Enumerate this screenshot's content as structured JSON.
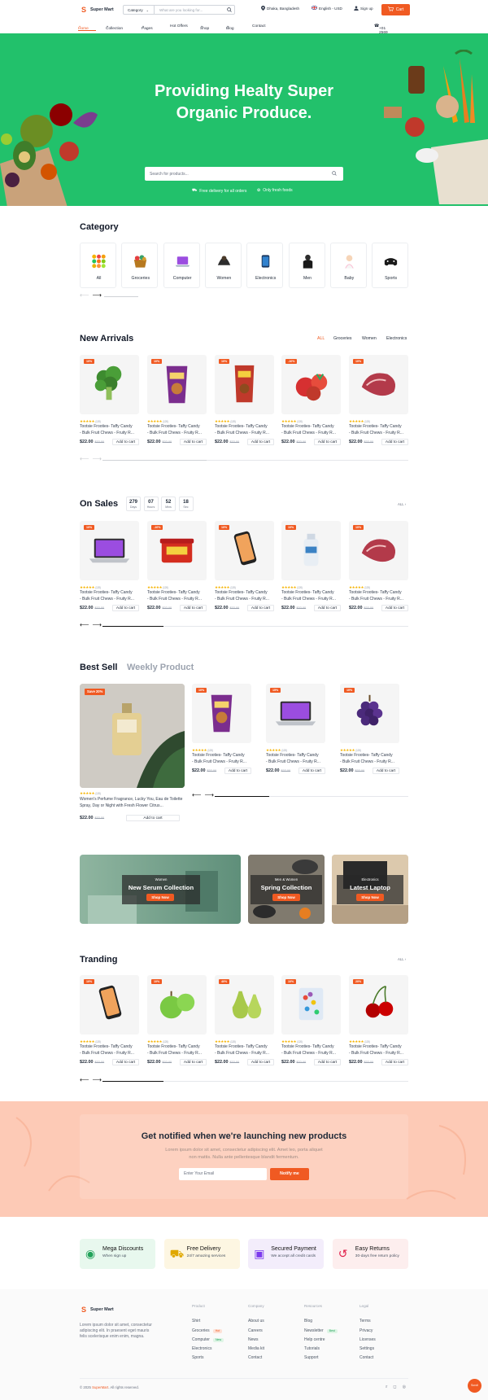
{
  "header": {
    "logo_letter": "S",
    "logo_name": "Super Mart",
    "category_label": "Category",
    "search_placeholder": "What are you looking for...",
    "location": "Dhaka, Bangladesh",
    "language": "English - USD",
    "signup": "Sign up",
    "cart": "Cart"
  },
  "nav": {
    "items": [
      "Home",
      "Collection",
      "Pages",
      "Hot Offers",
      "Shop",
      "Blog",
      "Contact"
    ],
    "phone": "+01 2569 8889"
  },
  "hero": {
    "title": "Providing Healty Super\nOrganic Produce.",
    "search_placeholder": "Search for products...",
    "feature1": "Free delivery for all orders",
    "feature2": "Only fresh foods"
  },
  "category": {
    "title": "Category",
    "items": [
      "All",
      "Groceries",
      "Computer",
      "Women",
      "Electronics",
      "Men",
      "Baby",
      "Sports"
    ]
  },
  "product": {
    "title": "Tootsie Frooties- Taffy Candy\n- Bulk Fruit Chews - Fruity R...",
    "price": "$22.00",
    "old_price": "$32.00",
    "add_to_cart": "Add to cart",
    "reviews": "(120)"
  },
  "new_arrivals": {
    "title": "New Arrivals",
    "filters": [
      "ALL",
      "Groceries",
      "Women",
      "Electronics"
    ],
    "badges": [
      "10%",
      "10%",
      "10%",
      "-10%",
      "10%"
    ],
    "items": [
      "broccoli",
      "candy-bag",
      "snack-bag",
      "tomatoes",
      "meat"
    ]
  },
  "on_sales": {
    "title": "On Sales",
    "countdown": [
      {
        "value": "279",
        "unit": "Days"
      },
      {
        "value": "07",
        "unit": "Hours"
      },
      {
        "value": "52",
        "unit": "Mins"
      },
      {
        "value": "18",
        "unit": "Sec"
      }
    ],
    "all_label": "ALL",
    "badges": [
      "10%",
      "-10%",
      "10%",
      "10%",
      "10%"
    ],
    "items": [
      "laptop",
      "candy-tub",
      "phone",
      "lotion",
      "meat"
    ]
  },
  "best_sell": {
    "tab1": "Best Sell",
    "tab2": "Weekly Product",
    "feature_badge": "Save 20%",
    "feature_title": "Women's Perfume Fragrance, Lucky You, Eau de Toilette Spray, Day or Night with Fresh Flower Citrus...",
    "badges": [
      "10%",
      "15%",
      "10%"
    ],
    "items": [
      "candy-bag",
      "laptop",
      "grapes"
    ]
  },
  "banners": [
    {
      "tag": "Women",
      "title": "New Serum Collection",
      "button": "Shop Now"
    },
    {
      "tag": "Men & Women",
      "title": "Spring Collection",
      "button": "Shop Now"
    },
    {
      "tag": "Electronics",
      "title": "Latest Laptop",
      "button": "Shop Now"
    }
  ],
  "trending": {
    "title": "Tranding",
    "all_label": "ALL",
    "badges": [
      "10%",
      "10%",
      "40%",
      "10%",
      "20%"
    ],
    "items": [
      "phone",
      "green-apple",
      "pears",
      "candy-jar",
      "cherries"
    ]
  },
  "newsletter": {
    "title": "Get notified when we're launching new products",
    "text": "Lorem ipsum dolor sit amet, consectetur adipiscing elit. Amet leo, porta aliquet\nnon mattis. Nulla ante pellentesque blandit fermentum.",
    "placeholder": "Enter Your Email",
    "button": "Notify me"
  },
  "features": [
    {
      "title": "Mega Discounts",
      "sub": "When sign up",
      "bg": "#e8f8ee"
    },
    {
      "title": "Free Delivery",
      "sub": "24/7 amazing services",
      "bg": "#fdf6e2"
    },
    {
      "title": "Secured Payment",
      "sub": "We accept all credit cards",
      "bg": "#f3edfb"
    },
    {
      "title": "Easy Returns",
      "sub": "30-days free return policy",
      "bg": "#fdeeee"
    }
  ],
  "footer": {
    "logo_name": "Super Mart",
    "about": "Lorem ipsum dolor sit amet, consectetur\nadipiscing elit. In praesent eget mauris\nfelis scelerisque enim enim, magna.",
    "product": {
      "heading": "Product",
      "links": [
        "Shirt",
        "Groceries",
        "Computer",
        "Electronics",
        "Sports"
      ],
      "tag_groceries": "Hot",
      "tag_computer": "New"
    },
    "company": {
      "heading": "Company",
      "links": [
        "About us",
        "Careers",
        "News",
        "Media kit",
        "Contact"
      ]
    },
    "resources": {
      "heading": "Resources",
      "links": [
        "Blog",
        "Newsletter",
        "Help centre",
        "Tutorials",
        "Support"
      ],
      "tag_newsletter": "Best"
    },
    "legal": {
      "heading": "Legal",
      "links": [
        "Terms",
        "Privacy",
        "Licenses",
        "Settings",
        "Contact"
      ]
    },
    "copyright_prefix": "© 2025",
    "copyright_brand": "SuperMart",
    "copyright_suffix": ". All rights reserved.",
    "scroll_label": "Scroll"
  },
  "colors": {
    "accent": "#f05a22",
    "hero_green": "#22c16b",
    "star": "#f5b301"
  }
}
